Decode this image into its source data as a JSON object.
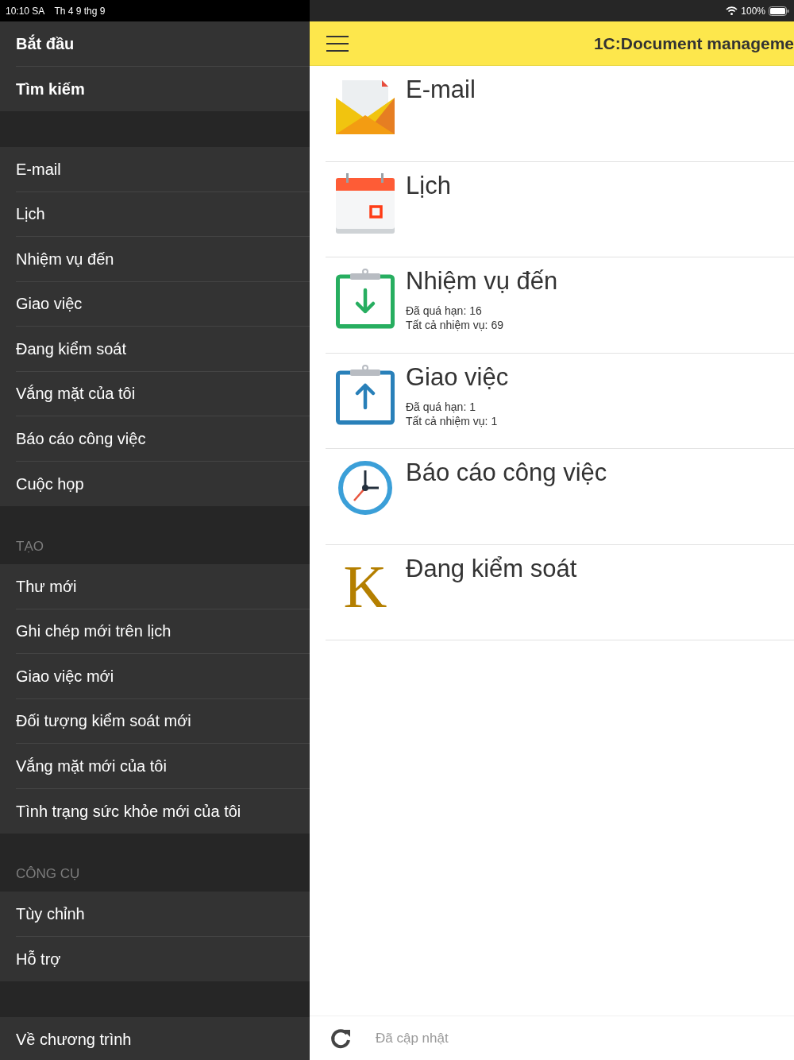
{
  "status_bar": {
    "time": "10:10 SA",
    "date": "Th 4 9 thg 9",
    "battery": "100%"
  },
  "sidebar": {
    "sections": [
      {
        "kind": "main",
        "items": [
          "Bắt đầu",
          "Tìm kiếm"
        ]
      },
      {
        "kind": "list",
        "items": [
          "E-mail",
          "Lịch",
          "Nhiệm vụ đến",
          "Giao việc",
          "Đang kiểm soát",
          "Vắng mặt của tôi",
          "Báo cáo công việc",
          "Cuộc họp"
        ]
      },
      {
        "kind": "list",
        "header": "TẠO",
        "items": [
          "Thư mới",
          "Ghi chép mới trên lịch",
          "Giao việc mới",
          "Đối tượng kiểm soát mới",
          "Vắng mặt mới của tôi",
          "Tình trạng sức khỏe mới của tôi"
        ]
      },
      {
        "kind": "list",
        "header": "CÔNG CỤ",
        "items": [
          "Tùy chỉnh",
          "Hỗ trợ"
        ]
      },
      {
        "kind": "list",
        "items": [
          "Về chương trình"
        ]
      }
    ]
  },
  "header": {
    "title": "1C:Document manageme"
  },
  "tiles": [
    {
      "kind": "email",
      "title": "E-mail"
    },
    {
      "kind": "calendar",
      "title": "Lịch"
    },
    {
      "kind": "incoming",
      "title": "Nhiệm vụ đến",
      "details": [
        "Đã quá hạn: 16",
        "Tất cả nhiệm vụ: 69"
      ]
    },
    {
      "kind": "outgoing",
      "title": "Giao việc",
      "details": [
        "Đã quá hạn: 1",
        "Tất cả nhiệm vụ: 1"
      ]
    },
    {
      "kind": "clock",
      "title": "Báo cáo công việc"
    },
    {
      "kind": "letter",
      "icon_letter": "K",
      "title": "Đang kiểm soát"
    }
  ],
  "footer": {
    "status": "Đã cập nhật"
  }
}
